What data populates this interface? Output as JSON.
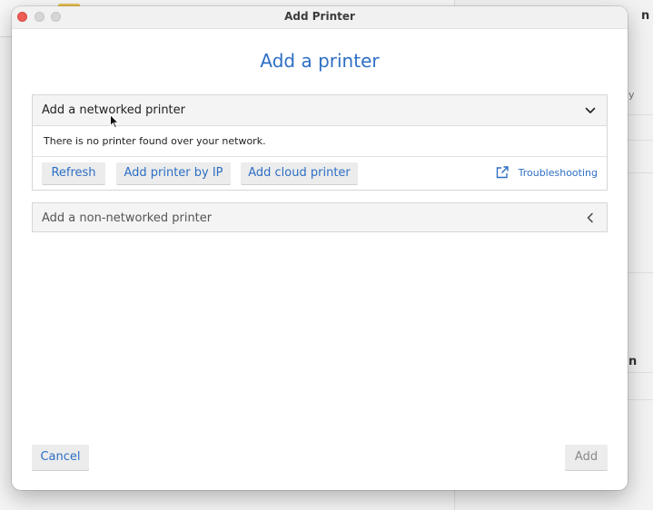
{
  "background_app": {
    "right_text_1": "n",
    "right_text_2": "y",
    "right_text_3": "n"
  },
  "window": {
    "title": "Add Printer",
    "heading": "Add a printer"
  },
  "networked": {
    "header_label": "Add a networked printer",
    "header_icon": "chevron-down-icon",
    "status_text": "There is no printer found over your network.",
    "buttons": {
      "refresh": "Refresh",
      "add_by_ip": "Add printer by IP",
      "add_cloud": "Add cloud printer"
    },
    "troubleshooting": {
      "label": "Troubleshooting",
      "icon": "external-link-icon"
    }
  },
  "non_networked": {
    "header_label": "Add a non-networked printer",
    "header_icon": "chevron-left-icon"
  },
  "footer": {
    "cancel_label": "Cancel",
    "add_label": "Add"
  },
  "colors": {
    "accent": "#2d6fc4",
    "close_button": "#ee5c55",
    "disabled_text": "#8a8a8a"
  }
}
